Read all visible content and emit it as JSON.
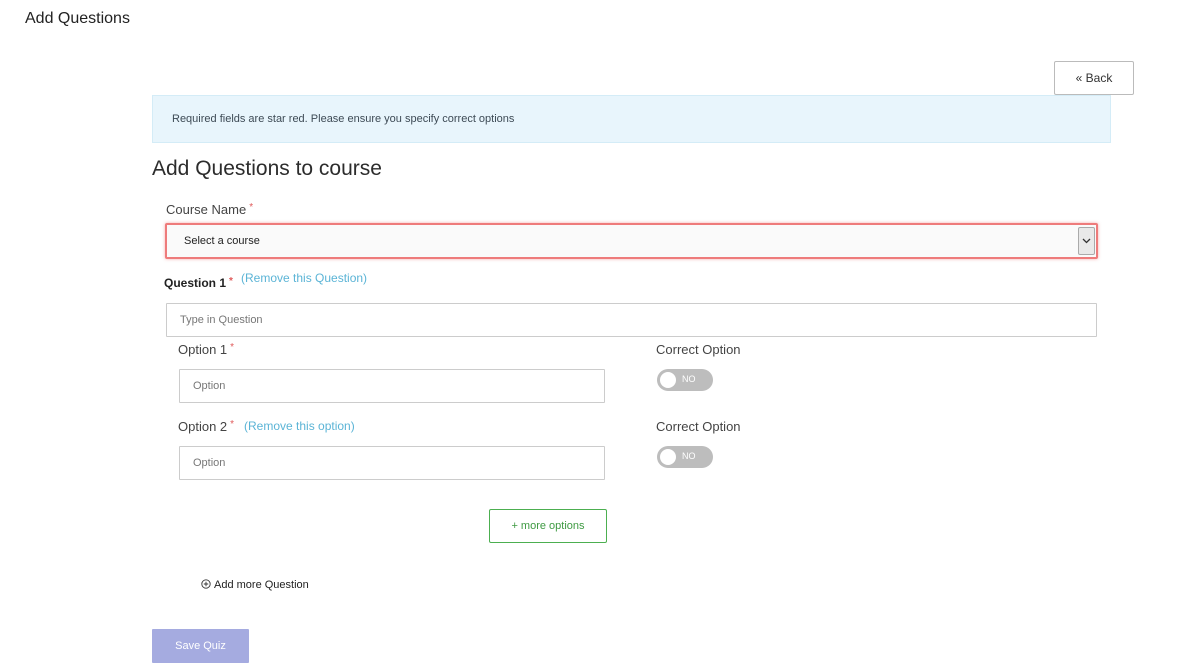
{
  "page": {
    "title": "Add Questions"
  },
  "toolbar": {
    "back_label": "« Back"
  },
  "alert": {
    "message": "Required fields are star red. Please ensure you specify correct options"
  },
  "form": {
    "section_title": "Add Questions to course",
    "course": {
      "label": "Course Name",
      "required_marker": "*",
      "selected_value": "Select a course"
    },
    "question": {
      "label": "Question 1",
      "required_marker": "*",
      "remove_label": "(Remove this Question)",
      "placeholder": "Type in Question",
      "options": [
        {
          "label": "Option 1",
          "required_marker": "*",
          "remove_label": "",
          "placeholder": "Option",
          "correct_label": "Correct Option",
          "toggle_text": "NO"
        },
        {
          "label": "Option 2",
          "required_marker": "*",
          "remove_label": "(Remove this option)",
          "placeholder": "Option",
          "correct_label": "Correct Option",
          "toggle_text": "NO"
        }
      ]
    },
    "more_options_label": "+ more options",
    "add_question_label": "Add more Question",
    "save_label": "Save Quiz"
  },
  "colors": {
    "required": "#e05a5a",
    "link": "#5bb4d6",
    "error_border": "#ee7b7b",
    "success": "#4caf50",
    "save_button": "#a5abe0",
    "alert_bg": "#e8f5fc"
  },
  "icons": {
    "select_arrow": "chevron-down-icon",
    "add_question": "plus-circle-icon"
  }
}
